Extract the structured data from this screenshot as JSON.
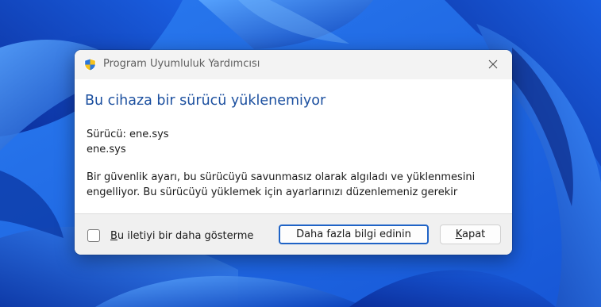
{
  "dialog": {
    "title": "Program Uyumluluk Yardımcısı",
    "heading": "Bu cihaza bir sürücü yüklenemiyor",
    "driver_label": "Sürücü: ene.sys",
    "driver_file": "ene.sys",
    "message_line1": "Bir güvenlik ayarı, bu sürücüyü savunmasız olarak algıladı ve yüklenmesini",
    "message_line2": "engelliyor. Bu sürücüyü yüklemek için ayarlarınızı düzenlemeniz gerekir",
    "checkbox": {
      "label_accel": "B",
      "label_rest": "u iletiyi bir daha gösterme",
      "checked": false
    },
    "buttons": {
      "more_info_label": "Daha fazla bilgi edinin",
      "close_accel": "K",
      "close_rest": "apat"
    }
  },
  "colors": {
    "heading": "#1b4f9f",
    "primary_border": "#1f63c6",
    "titlebar_bg": "#f3f3f3",
    "footer_bg": "#f0f0f0"
  },
  "icons": {
    "title": "uac-shield-icon",
    "close": "close-icon"
  }
}
